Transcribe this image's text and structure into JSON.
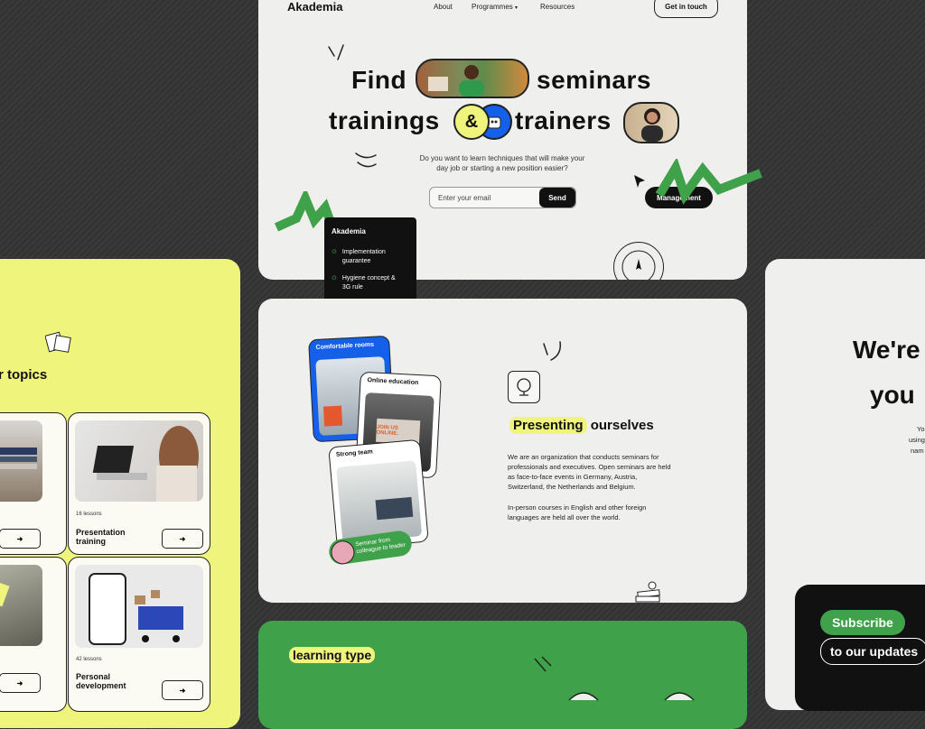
{
  "colors": {
    "accent_green": "#3fa14a",
    "accent_yellow": "#eef47c",
    "accent_blue": "#1560e8",
    "dark": "#111111",
    "light_bg": "#efefed"
  },
  "hero": {
    "logo": "Akademia",
    "nav": {
      "about": "About",
      "programmes": "Programmes",
      "resources": "Resources",
      "chevron_icon": "chevron-down-icon"
    },
    "cta": "Get in touch",
    "headline": {
      "find": "Find",
      "seminars": "seminars",
      "trainings": "trainings",
      "amp": "&",
      "trainers": "trainers"
    },
    "subtitle_line1": "Do you want to learn techniques that will make your",
    "subtitle_line2": "day job or starting a new position easier?",
    "email_placeholder": "Enter your email",
    "send": "Send",
    "black_card": {
      "logo": "Akademia",
      "item1_l1": "Implementation",
      "item1_l2": "guarantee",
      "item2_l1": "Hygiene concept &",
      "item2_l2": "3G rule"
    },
    "management": "Management",
    "stamp_icon": "compass-stamp-icon"
  },
  "present": {
    "card1": "Comfortable rooms",
    "card2": "Online education",
    "card2_screen": "JOIN US ONLINE.",
    "card3": "Strong team",
    "tag_l1": "Seminar from",
    "tag_l2": "colleague to leader",
    "title_hl": "Presenting",
    "title_rest": " ourselves",
    "p1_l1": "We are an organization that conducts seminars for",
    "p1_l2": "professionals and executives. Open seminars are held",
    "p1_l3": "as face-to-face events in Germany, Austria,",
    "p1_l4": "Switzerland, the Netherlands and Belgium.",
    "p2_l1": "In-person courses in English and other foreign",
    "p2_l2": "languages are held all over the world.",
    "globe_icon": "globe-icon"
  },
  "topics": {
    "title": "r topics",
    "cards": [
      {
        "lessons": "16 lessons",
        "name_l1": "Presentation",
        "name_l2": "training",
        "arrow": "➜"
      },
      {
        "lessons": "42 lessons",
        "name_l1": "Personal",
        "name_l2": "development",
        "arrow": "➜"
      }
    ],
    "arrow": "➜"
  },
  "green_section": {
    "title": "learning type"
  },
  "right_panel": {
    "line1": "We're",
    "line2": "you",
    "t1": "Yo",
    "t2": "using",
    "t3": "nam"
  },
  "subscribe": {
    "button": "Subscribe",
    "text": "to our updates"
  }
}
